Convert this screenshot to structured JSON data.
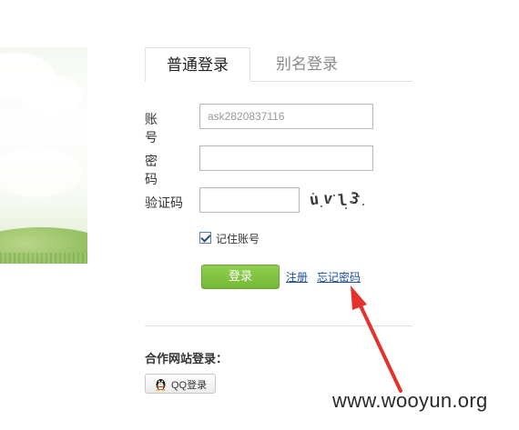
{
  "tabs": [
    {
      "label": "普通登录",
      "active": true
    },
    {
      "label": "别名登录",
      "active": false
    }
  ],
  "form": {
    "account_label": "账号",
    "account_value": "ask2820837116",
    "password_label": "密码",
    "password_value": "",
    "captcha_label": "验证码",
    "captcha_value": "",
    "captcha_text": "uvl3",
    "remember_label": "记住账号",
    "remember_checked": true,
    "login_label": "登录",
    "register_link": "注册",
    "forgot_link": "忘记密码"
  },
  "partner": {
    "title": "合作网站登录：",
    "qq_label": "QQ登录"
  },
  "watermark": "www.wooyun.org",
  "colors": {
    "login_green": "#7bbd3c",
    "link_blue": "#1a4e9a",
    "annotation_red": "#e5322d"
  }
}
